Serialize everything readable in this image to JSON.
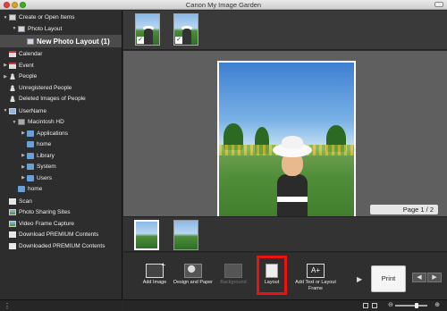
{
  "window": {
    "title": "Canon My Image Garden"
  },
  "sidebar": {
    "items": [
      {
        "label": "Create or Open Items",
        "indent": 0,
        "arrow": "▼",
        "icon": "box-icon"
      },
      {
        "label": "Photo Layout",
        "indent": 1,
        "arrow": "▼",
        "icon": "box-icon"
      },
      {
        "label": "New Photo Layout (1)",
        "indent": 2,
        "arrow": "",
        "icon": "box-icon",
        "selected": true
      },
      {
        "label": "Calendar",
        "indent": 0,
        "arrow": "",
        "icon": "calendar-icon"
      },
      {
        "label": "Event",
        "indent": 0,
        "arrow": "▶",
        "icon": "calendar-icon"
      },
      {
        "label": "People",
        "indent": 0,
        "arrow": "▶",
        "icon": "person-icon"
      },
      {
        "label": "Unregistered People",
        "indent": 0,
        "arrow": "",
        "icon": "person-icon"
      },
      {
        "label": "Deleted Images of People",
        "indent": 0,
        "arrow": "",
        "icon": "person-icon"
      },
      {
        "label": "UserName",
        "indent": 0,
        "arrow": "▼",
        "icon": "monitor-icon"
      },
      {
        "label": "Macintosh HD",
        "indent": 1,
        "arrow": "▼",
        "icon": "hard-drive-icon"
      },
      {
        "label": "Applications",
        "indent": 2,
        "arrow": "▶",
        "icon": "folder-icon"
      },
      {
        "label": "home",
        "indent": 2,
        "arrow": "",
        "icon": "folder-icon"
      },
      {
        "label": "Library",
        "indent": 2,
        "arrow": "▶",
        "icon": "folder-icon"
      },
      {
        "label": "System",
        "indent": 2,
        "arrow": "▶",
        "icon": "folder-icon"
      },
      {
        "label": "Users",
        "indent": 2,
        "arrow": "▶",
        "icon": "folder-icon"
      },
      {
        "label": "home",
        "indent": 1,
        "arrow": "",
        "icon": "folder-icon"
      },
      {
        "label": "Scan",
        "indent": 0,
        "arrow": "",
        "icon": "scanner-icon"
      },
      {
        "label": "Photo Sharing Sites",
        "indent": 0,
        "arrow": "",
        "icon": "photo-icon"
      },
      {
        "label": "Video Frame Capture",
        "indent": 0,
        "arrow": "",
        "icon": "photo-icon"
      },
      {
        "label": "Download PREMIUM Contents",
        "indent": 0,
        "arrow": "",
        "icon": "document-icon"
      },
      {
        "label": "Downloaded PREMIUM Contents",
        "indent": 0,
        "arrow": "",
        "icon": "document-icon"
      }
    ]
  },
  "canvas": {
    "page_label": "Page 1 / 2"
  },
  "toolbar": {
    "add_image": "Add Image",
    "design_paper": "Design and Paper",
    "background": "Background",
    "layout": "Layout",
    "add_text": "Add Text or Layout Frame",
    "print": "Print"
  },
  "colors": {
    "highlight": "#ee1111",
    "background": "#2b2b2b"
  }
}
